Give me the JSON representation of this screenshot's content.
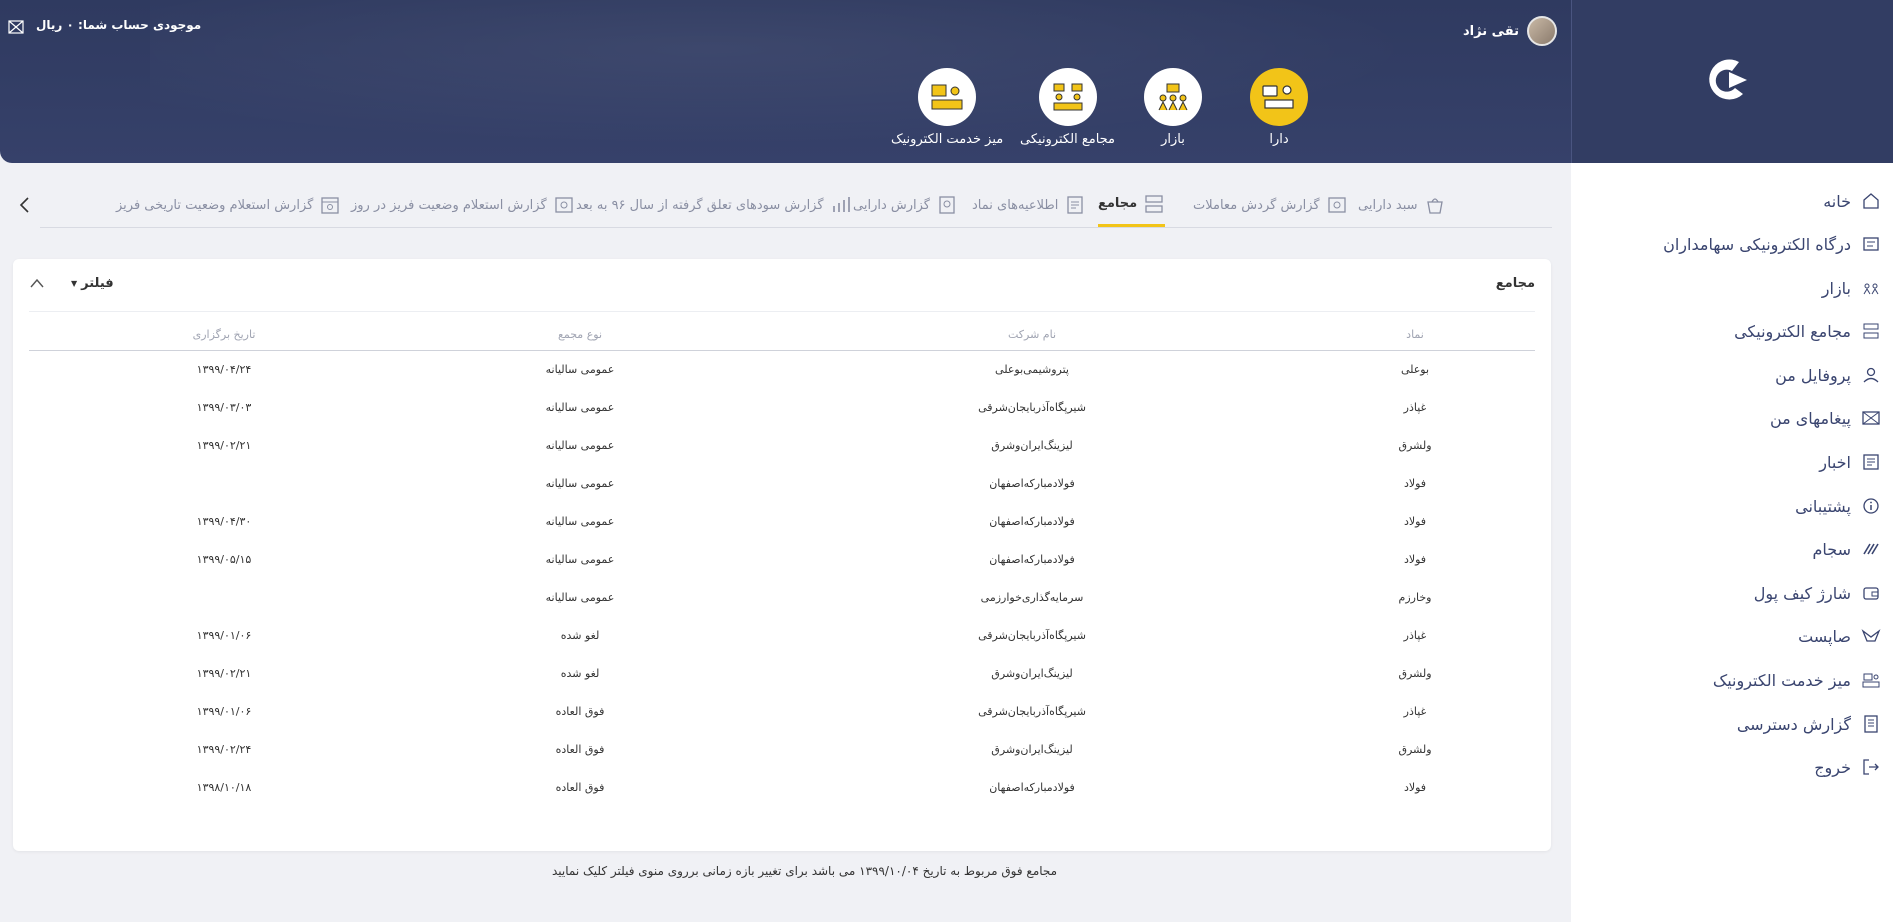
{
  "header": {
    "user_name": "تقی نژاد",
    "balance_text": "موجودی حساب شما: ۰ ریال",
    "nav": [
      {
        "label": "دارا",
        "active": true
      },
      {
        "label": "بازار",
        "active": false
      },
      {
        "label": "مجامع الکترونیکی",
        "active": false
      },
      {
        "label": "میز خدمت الکترونیک",
        "active": false
      }
    ]
  },
  "sidebar": {
    "items": [
      {
        "label": "خانه",
        "icon": "home-icon"
      },
      {
        "label": "درگاه الکترونیکی سهامداران",
        "icon": "portal-icon"
      },
      {
        "label": "بازار",
        "icon": "market-icon"
      },
      {
        "label": "مجامع الکترونیکی",
        "icon": "assembly-icon"
      },
      {
        "label": "پروفایل من",
        "icon": "user-icon"
      },
      {
        "label": "پیغامهای من",
        "icon": "mail-icon"
      },
      {
        "label": "اخبار",
        "icon": "news-icon"
      },
      {
        "label": "پشتیبانی",
        "icon": "info-icon"
      },
      {
        "label": "سجام",
        "icon": "sejam-icon"
      },
      {
        "label": "شارژ کیف پول",
        "icon": "wallet-icon"
      },
      {
        "label": "صاپست",
        "icon": "sapost-icon"
      },
      {
        "label": "میز خدمت الکترونیک",
        "icon": "service-desk-icon"
      },
      {
        "label": "گزارش دسترسی",
        "icon": "report-icon"
      },
      {
        "label": "خروج",
        "icon": "logout-icon"
      }
    ]
  },
  "tabs": [
    {
      "label": "سبد دارایی",
      "active": false
    },
    {
      "label": "گزارش گردش معاملات",
      "active": false
    },
    {
      "label": "مجامع",
      "active": true
    },
    {
      "label": "اطلاعیه‌های نماد",
      "active": false
    },
    {
      "label": "گزارش دارایی",
      "active": false
    },
    {
      "label": "گزارش سودهای تعلق گرفته از سال ۹۶ به بعد",
      "active": false
    },
    {
      "label": "گزارش استعلام وضعیت فریز در روز",
      "active": false
    },
    {
      "label": "گزارش استعلام وضعیت تاریخی فریز",
      "active": false
    }
  ],
  "card": {
    "title": "مجامع",
    "filter_label": "فیلتر",
    "columns": [
      "نماد",
      "نام شرکت",
      "نوع مجمع",
      "تاریخ برگزاری"
    ],
    "rows": [
      [
        "بوعلی",
        "پتروشیمی‌بوعلی",
        "عمومی سالیانه",
        "۱۳۹۹/۰۴/۲۴"
      ],
      [
        "غپاذر",
        "شیرپگاه‌آذربایجان‌شرقی",
        "عمومی سالیانه",
        "۱۳۹۹/۰۳/۰۳"
      ],
      [
        "ولشرق",
        "لیزینگ‌ایران‌وشرق",
        "عمومی سالیانه",
        "۱۳۹۹/۰۲/۲۱"
      ],
      [
        "فولاد",
        "فولادمبارکه‌اصفهان",
        "عمومی سالیانه",
        ""
      ],
      [
        "فولاد",
        "فولادمبارکه‌اصفهان",
        "عمومی سالیانه",
        "۱۳۹۹/۰۴/۳۰"
      ],
      [
        "فولاد",
        "فولادمبارکه‌اصفهان",
        "عمومی سالیانه",
        "۱۳۹۹/۰۵/۱۵"
      ],
      [
        "وخارزم",
        "سرمایه‌گذاری‌خوارزمی",
        "عمومی سالیانه",
        ""
      ],
      [
        "غپاذر",
        "شیرپگاه‌آذربایجان‌شرقی",
        "لغو شده",
        "۱۳۹۹/۰۱/۰۶"
      ],
      [
        "ولشرق",
        "لیزینگ‌ایران‌وشرق",
        "لغو شده",
        "۱۳۹۹/۰۲/۲۱"
      ],
      [
        "غپاذر",
        "شیرپگاه‌آذربایجان‌شرقی",
        "فوق العاده",
        "۱۳۹۹/۰۱/۰۶"
      ],
      [
        "ولشرق",
        "لیزینگ‌ایران‌وشرق",
        "فوق العاده",
        "۱۳۹۹/۰۲/۲۴"
      ],
      [
        "فولاد",
        "فولادمبارکه‌اصفهان",
        "فوق العاده",
        "۱۳۹۸/۱۰/۱۸"
      ]
    ]
  },
  "footer_note": "مجامع فوق مربوط به تاریخ ۱۳۹۹/۱۰/۰۴ می باشد برای تغییر بازه زمانی برروی منوی فیلتر کلیک نمایید",
  "colors": {
    "header": "#2f3a60",
    "accent": "#f2c418",
    "sidebar_text": "#3a4570"
  }
}
